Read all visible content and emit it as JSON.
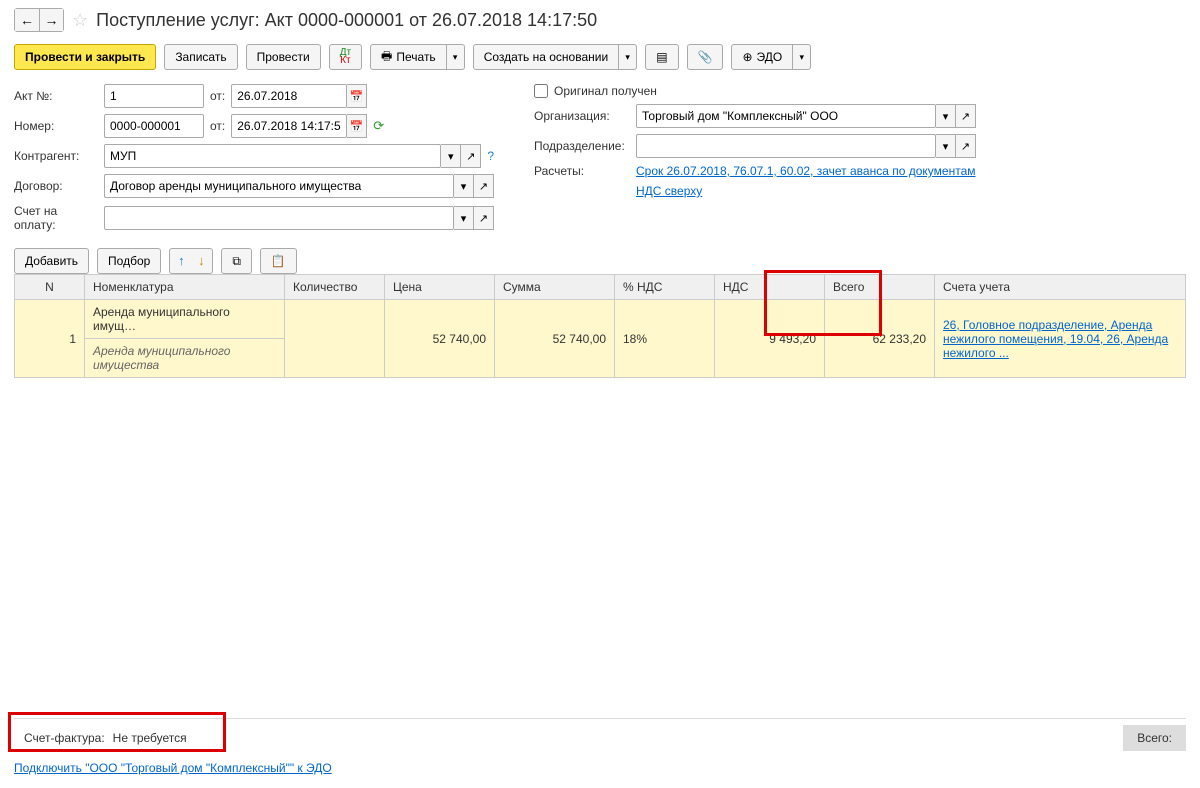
{
  "header": {
    "title": "Поступление услуг: Акт 0000-000001 от 26.07.2018 14:17:50"
  },
  "toolbar": {
    "post_close": "Провести и закрыть",
    "write": "Записать",
    "post": "Провести",
    "print": "Печать",
    "create_based": "Создать на основании",
    "edo": "ЭДО"
  },
  "form": {
    "act_no_label": "Акт №:",
    "act_no_value": "1",
    "from_label": "от:",
    "act_date": "26.07.2018",
    "number_label": "Номер:",
    "number_value": "0000-000001",
    "number_date": "26.07.2018 14:17:50",
    "counterparty_label": "Контрагент:",
    "counterparty_value": "МУП",
    "contract_label": "Договор:",
    "contract_value": "Договор аренды муниципального имущества",
    "invoice_pay_label": "Счет на оплату:",
    "original_label": "Оригинал получен",
    "org_label": "Организация:",
    "org_value": "Торговый дом \"Комплексный\" ООО",
    "dept_label": "Подразделение:",
    "calc_label": "Расчеты:",
    "calc_link": "Срок 26.07.2018, 76.07.1, 60.02, зачет аванса по документам",
    "vat_link": "НДС сверху"
  },
  "table_toolbar": {
    "add": "Добавить",
    "select": "Подбор"
  },
  "table": {
    "headers": {
      "n": "N",
      "item": "Номенклатура",
      "qty": "Количество",
      "price": "Цена",
      "sum": "Сумма",
      "vat_pct": "% НДС",
      "vat": "НДС",
      "total": "Всего",
      "accounts": "Счета учета"
    },
    "rows": [
      {
        "n": "1",
        "item": "Аренда муниципального имущ…",
        "item_sub": "Аренда муниципального имущества",
        "qty": "",
        "price": "52 740,00",
        "sum": "52 740,00",
        "vat_pct": "18%",
        "vat": "9 493,20",
        "total": "62 233,20",
        "accounts": "26, Головное подразделение, Аренда нежилого помещения, 19.04, 26, Аренда нежилого ..."
      }
    ]
  },
  "footer": {
    "invoice_label": "Счет-фактура:",
    "invoice_value": "Не требуется",
    "total_label": "Всего:",
    "edo_link": "Подключить \"ООО \"Торговый дом \"Комплексный\"\" к ЭДО"
  }
}
